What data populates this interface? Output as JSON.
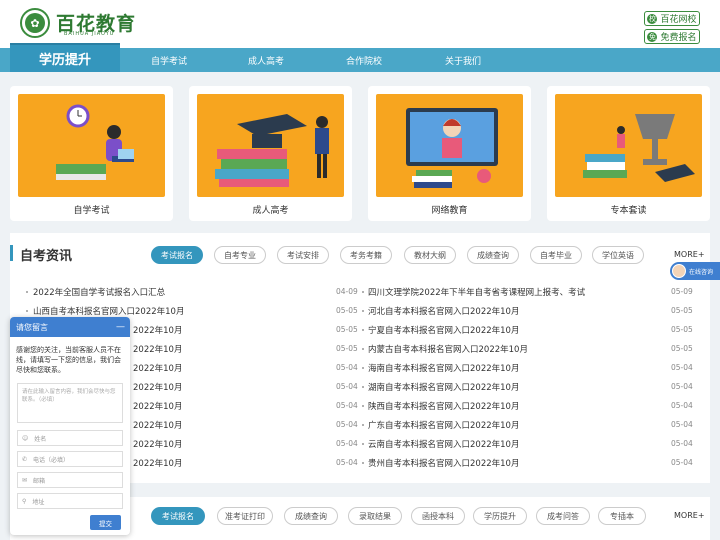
{
  "header": {
    "brand": "百花教育",
    "brand_sub": "BAIHUA JIAOYU",
    "logo_icon": "flower-logo",
    "right_buttons": [
      {
        "label": "百花网校",
        "icon": "school-icon"
      },
      {
        "label": "免费报名",
        "icon": "signup-icon"
      }
    ]
  },
  "nav": {
    "active": "学历提升",
    "items": [
      "自学考试",
      "成人高考",
      "合作院校",
      "关于我们"
    ]
  },
  "cards": [
    {
      "label": "自学考试"
    },
    {
      "label": "成人高考"
    },
    {
      "label": "网络教育"
    },
    {
      "label": "专本套读"
    }
  ],
  "section1": {
    "title": "自考资讯",
    "tabs": [
      "考试报名",
      "自考专业",
      "考试安排",
      "考务考籍",
      "教材大纲",
      "成绩查询",
      "自考毕业",
      "学位英语"
    ],
    "more": "MORE+",
    "left_news": [
      {
        "title": "2022年全国自学考试报名入口汇总",
        "date": "04-09"
      },
      {
        "title": "山西自考本科报名官网入口2022年10月",
        "date": "05-05"
      },
      {
        "title": "2022年10月",
        "date": "05-05"
      },
      {
        "title": "2022年10月",
        "date": "05-05"
      },
      {
        "title": "2022年10月",
        "date": "05-04"
      },
      {
        "title": "2022年10月",
        "date": "05-04"
      },
      {
        "title": "2022年10月",
        "date": "05-04"
      },
      {
        "title": "2022年10月",
        "date": "05-04"
      },
      {
        "title": "2022年10月",
        "date": "05-04"
      },
      {
        "title": "2022年10月",
        "date": "05-04"
      }
    ],
    "right_news": [
      {
        "title": "四川文理学院2022年下半年自考省考课程网上报考、考试",
        "date": "05-09"
      },
      {
        "title": "河北自考本科报名官网入口2022年10月",
        "date": "05-05"
      },
      {
        "title": "宁夏自考本科报名官网入口2022年10月",
        "date": "05-05"
      },
      {
        "title": "内蒙古自考本科报名官网入口2022年10月",
        "date": "05-05"
      },
      {
        "title": "海南自考本科报名官网入口2022年10月",
        "date": "05-04"
      },
      {
        "title": "湖南自考本科报名官网入口2022年10月",
        "date": "05-04"
      },
      {
        "title": "陕西自考本科报名官网入口2022年10月",
        "date": "05-04"
      },
      {
        "title": "广东自考本科报名官网入口2022年10月",
        "date": "05-04"
      },
      {
        "title": "云南自考本科报名官网入口2022年10月",
        "date": "05-04"
      },
      {
        "title": "贵州自考本科报名官网入口2022年10月",
        "date": "05-04"
      }
    ]
  },
  "section2": {
    "tabs": [
      "考试报名",
      "准考证打印",
      "成绩查询",
      "录取结果",
      "函授本科",
      "学历提升",
      "成考问答",
      "专插本"
    ],
    "more": "MORE+"
  },
  "chat": {
    "title": "请您留言",
    "minimize": "—",
    "message": "感谢您的关注，当前客服人员不在线，请填写一下您的信息，我们会尽快和您联系。",
    "textarea_placeholder": "请在此输入留言内容，我们会尽快与您联系。（必填）",
    "fields": [
      {
        "placeholder": "姓名",
        "icon": "person-icon"
      },
      {
        "placeholder": "电话（必填）",
        "icon": "phone-icon"
      },
      {
        "placeholder": "邮箱",
        "icon": "mail-icon"
      },
      {
        "placeholder": "地址",
        "icon": "location-icon"
      }
    ],
    "submit": "提交"
  },
  "online_badge": {
    "label": "在线咨询"
  },
  "colors": {
    "brand_green": "#2e7a32",
    "nav_blue": "#4aa7c8",
    "active_blue": "#3496bd",
    "card_orange": "#f7a51f",
    "chat_blue": "#3f7fd0"
  }
}
